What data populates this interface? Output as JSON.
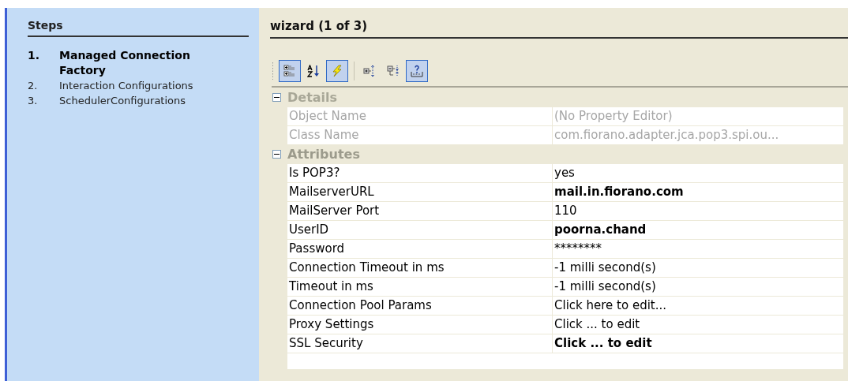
{
  "steps": {
    "title": "Steps",
    "items": [
      {
        "number": "1.",
        "label": "Managed Connection Factory",
        "selected": true
      },
      {
        "number": "2.",
        "label": "Interaction Configurations",
        "selected": false
      },
      {
        "number": "3.",
        "label": "SchedulerConfigurations",
        "selected": false
      }
    ]
  },
  "wizard": {
    "title": "wizard (1 of 3)"
  },
  "toolbar": [
    {
      "kind": "categorized",
      "selected": true
    },
    {
      "kind": "sort",
      "selected": false
    },
    {
      "kind": "lightning",
      "selected": true
    },
    {
      "kind": "separator",
      "selected": false
    },
    {
      "kind": "expand",
      "selected": false
    },
    {
      "kind": "collapse",
      "selected": false
    },
    {
      "kind": "help",
      "selected": true
    }
  ],
  "sections": [
    {
      "title": "Details",
      "expanded": true,
      "disabled": true,
      "rows": [
        {
          "name": "Object Name",
          "value": "(No Property Editor)",
          "modified": false
        },
        {
          "name": "Class Name",
          "value": "com.fiorano.adapter.jca.pop3.spi.ou...",
          "modified": false
        }
      ]
    },
    {
      "title": "Attributes",
      "expanded": true,
      "disabled": false,
      "rows": [
        {
          "name": "Is POP3?",
          "value": "yes",
          "modified": false
        },
        {
          "name": "MailserverURL",
          "value": "mail.in.fiorano.com",
          "modified": true
        },
        {
          "name": "MailServer Port",
          "value": "110",
          "modified": false
        },
        {
          "name": "UserID",
          "value": "poorna.chand",
          "modified": true
        },
        {
          "name": "Password",
          "value": "********",
          "modified": false
        },
        {
          "name": "Connection Timeout in ms",
          "value": "-1 milli second(s)",
          "modified": false
        },
        {
          "name": "Timeout in ms",
          "value": "-1 milli second(s)",
          "modified": false
        },
        {
          "name": "Connection Pool Params",
          "value": "Click here to edit...",
          "modified": false
        },
        {
          "name": "Proxy Settings",
          "value": "Click ... to edit",
          "modified": false
        },
        {
          "name": "SSL Security",
          "value": "Click ... to edit",
          "modified": true
        }
      ]
    }
  ]
}
